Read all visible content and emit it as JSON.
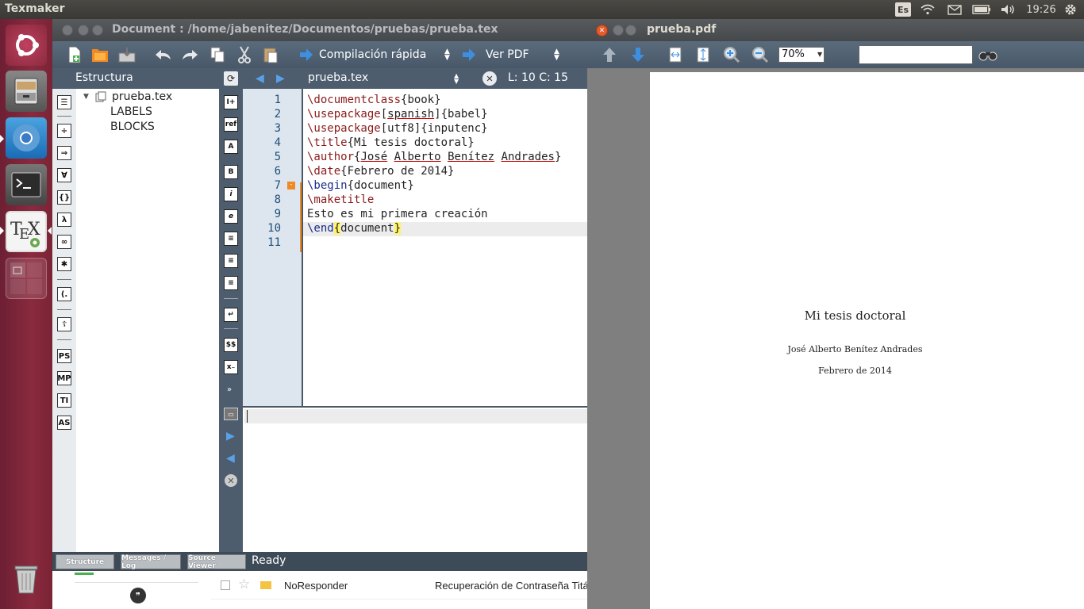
{
  "topbar": {
    "app_name": "Texmaker",
    "keyboard_layout": "Es",
    "clock": "19:26"
  },
  "launcher": {
    "items": [
      "ubuntu-dash",
      "files",
      "chromium",
      "terminal",
      "texmaker",
      "workspace-switcher",
      "trash"
    ]
  },
  "texmaker": {
    "title": "Document : /home/jabenitez/Documentos/pruebas/prueba.tex",
    "toolbar": {
      "build_combo": "Compilación rápida",
      "view_combo": "Ver PDF"
    },
    "structure": {
      "header": "Estructura",
      "root": "prueba.tex",
      "children": [
        "LABELS",
        "BLOCKS"
      ]
    },
    "editor": {
      "file_combo": "prueba.tex",
      "cursor_pos": "L: 10 C: 15",
      "line_numbers": [
        "1",
        "2",
        "3",
        "4",
        "5",
        "6",
        "7",
        "8",
        "9",
        "10",
        "11"
      ],
      "lines": {
        "l1a": "\\documentclass",
        "l1b": "{book}",
        "l2a": "\\usepackage",
        "l2b": "[",
        "l2c": "spanish",
        "l2d": "]{babel}",
        "l3a": "\\usepackage",
        "l3b": "[utf8]{inputenc}",
        "l4a": "\\title",
        "l4b": "{Mi tesis doctoral}",
        "l5a": "\\author",
        "l5b": "{",
        "l5c": "José",
        "l5d": " ",
        "l5e": "Alberto",
        "l5f": " ",
        "l5g": "Benítez",
        "l5h": " ",
        "l5i": "Andrades",
        "l5j": "}",
        "l6a": "\\date",
        "l6b": "{Febrero de 2014}",
        "l7a": "\\begin",
        "l7b": "{document}",
        "l8a": "\\maketitle",
        "l9a": "Esto es mi primera creación",
        "l10a": "\\end",
        "l10b": "{",
        "l10c": "document",
        "l10d": "}"
      }
    },
    "status": {
      "tab_structure": "Structure",
      "tab_messages": "Messages / Log",
      "tab_source": "Source Viewer",
      "text": "Ready"
    }
  },
  "pdf": {
    "title": "prueba.pdf",
    "zoom": "70%",
    "search_value": "",
    "page": {
      "title": "Mi tesis doctoral",
      "author": "José Alberto Benítez Andrades",
      "date": "Febrero de 2014"
    }
  },
  "background_window": {
    "sender": "NoResponder",
    "subject": "Recuperación de Contraseña Titá"
  },
  "colors": {
    "launcher": "#7a2436",
    "toolbar": "#4d5d6e",
    "command": "#8b1a1a",
    "env": "#1a2a8b",
    "line_number": "#1f4f7a"
  }
}
